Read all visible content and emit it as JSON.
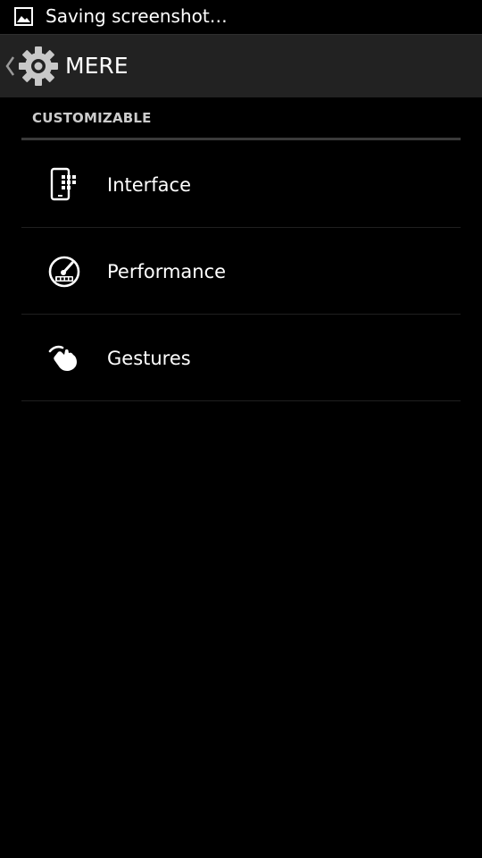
{
  "status_bar": {
    "notification_icon": "image-icon",
    "text": "Saving screenshot…"
  },
  "action_bar": {
    "back_icon": "chevron-left-icon",
    "app_icon": "gear-icon",
    "title": "MERE"
  },
  "section": {
    "header": "CUSTOMIZABLE"
  },
  "items": [
    {
      "icon": "phone-grid-icon",
      "title": "Interface"
    },
    {
      "icon": "speedometer-icon",
      "title": "Performance"
    },
    {
      "icon": "swipe-hand-icon",
      "title": "Gestures"
    }
  ],
  "colors": {
    "background": "#000000",
    "action_bar": "#222222",
    "divider": "#3a3a3a",
    "text": "#ffffff",
    "header_text": "#cccccc"
  }
}
